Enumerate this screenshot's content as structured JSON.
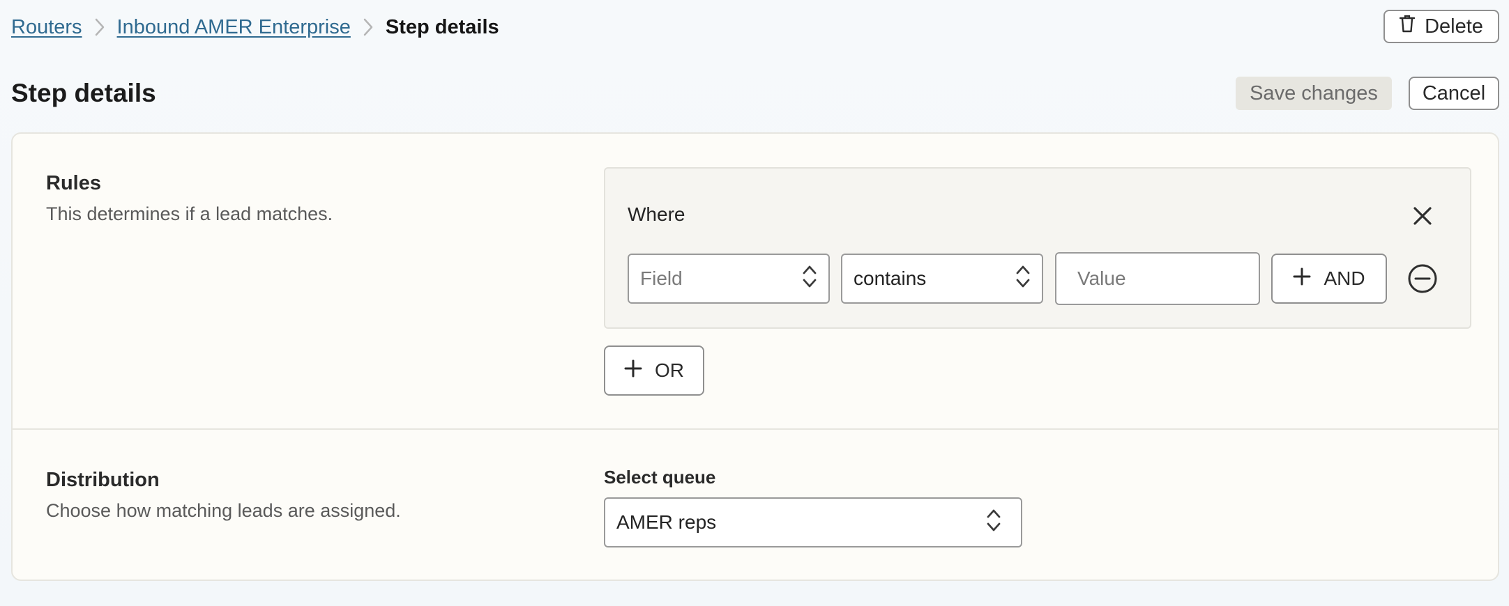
{
  "breadcrumb": {
    "items": [
      {
        "label": "Routers"
      },
      {
        "label": "Inbound AMER Enterprise"
      }
    ],
    "current": "Step details"
  },
  "header": {
    "delete_label": "Delete",
    "title": "Step details",
    "save_label": "Save changes",
    "cancel_label": "Cancel"
  },
  "rules": {
    "title": "Rules",
    "description": "This determines if a lead matches.",
    "where_label": "Where",
    "condition": {
      "field_placeholder": "Field",
      "operator_value": "contains",
      "value_placeholder": "Value"
    },
    "and_label": "AND",
    "or_label": "OR"
  },
  "distribution": {
    "title": "Distribution",
    "description": "Choose how matching leads are assigned.",
    "queue_label": "Select queue",
    "queue_value": "AMER reps"
  },
  "icons": {
    "delete": "trash-icon",
    "close": "close-icon",
    "chevron": "chevron-right-icon",
    "updown": "chevron-up-down-icon",
    "plus": "plus-icon",
    "remove": "minus-circle-icon"
  },
  "colors": {
    "link": "#2f6a90",
    "card_bg": "#fdfcf8",
    "group_bg": "#f6f5f1",
    "save_disabled_bg": "#e7e6e0"
  }
}
